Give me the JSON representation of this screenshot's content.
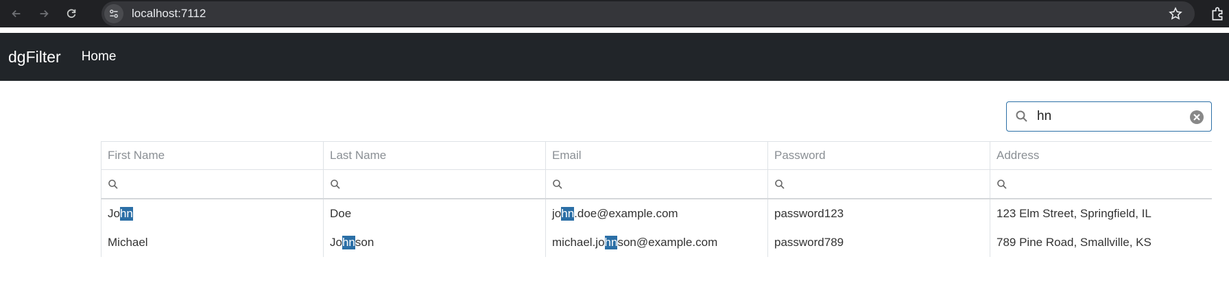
{
  "browser": {
    "url": "localhost:7112"
  },
  "app": {
    "brand": "dgFilter",
    "nav_home": "Home"
  },
  "search": {
    "value": "hn",
    "highlight": "hn"
  },
  "grid": {
    "columns": [
      "First Name",
      "Last Name",
      "Email",
      "Password",
      "Address"
    ],
    "rows": [
      [
        "John",
        "Doe",
        "john.doe@example.com",
        "password123",
        "123 Elm Street, Springfield, IL"
      ],
      [
        "Michael",
        "Johnson",
        "michael.johnson@example.com",
        "password789",
        "789 Pine Road, Smallville, KS"
      ]
    ]
  },
  "colors": {
    "highlight": "#2b6fa6",
    "navbar": "#212529",
    "chrome": "#202124"
  }
}
